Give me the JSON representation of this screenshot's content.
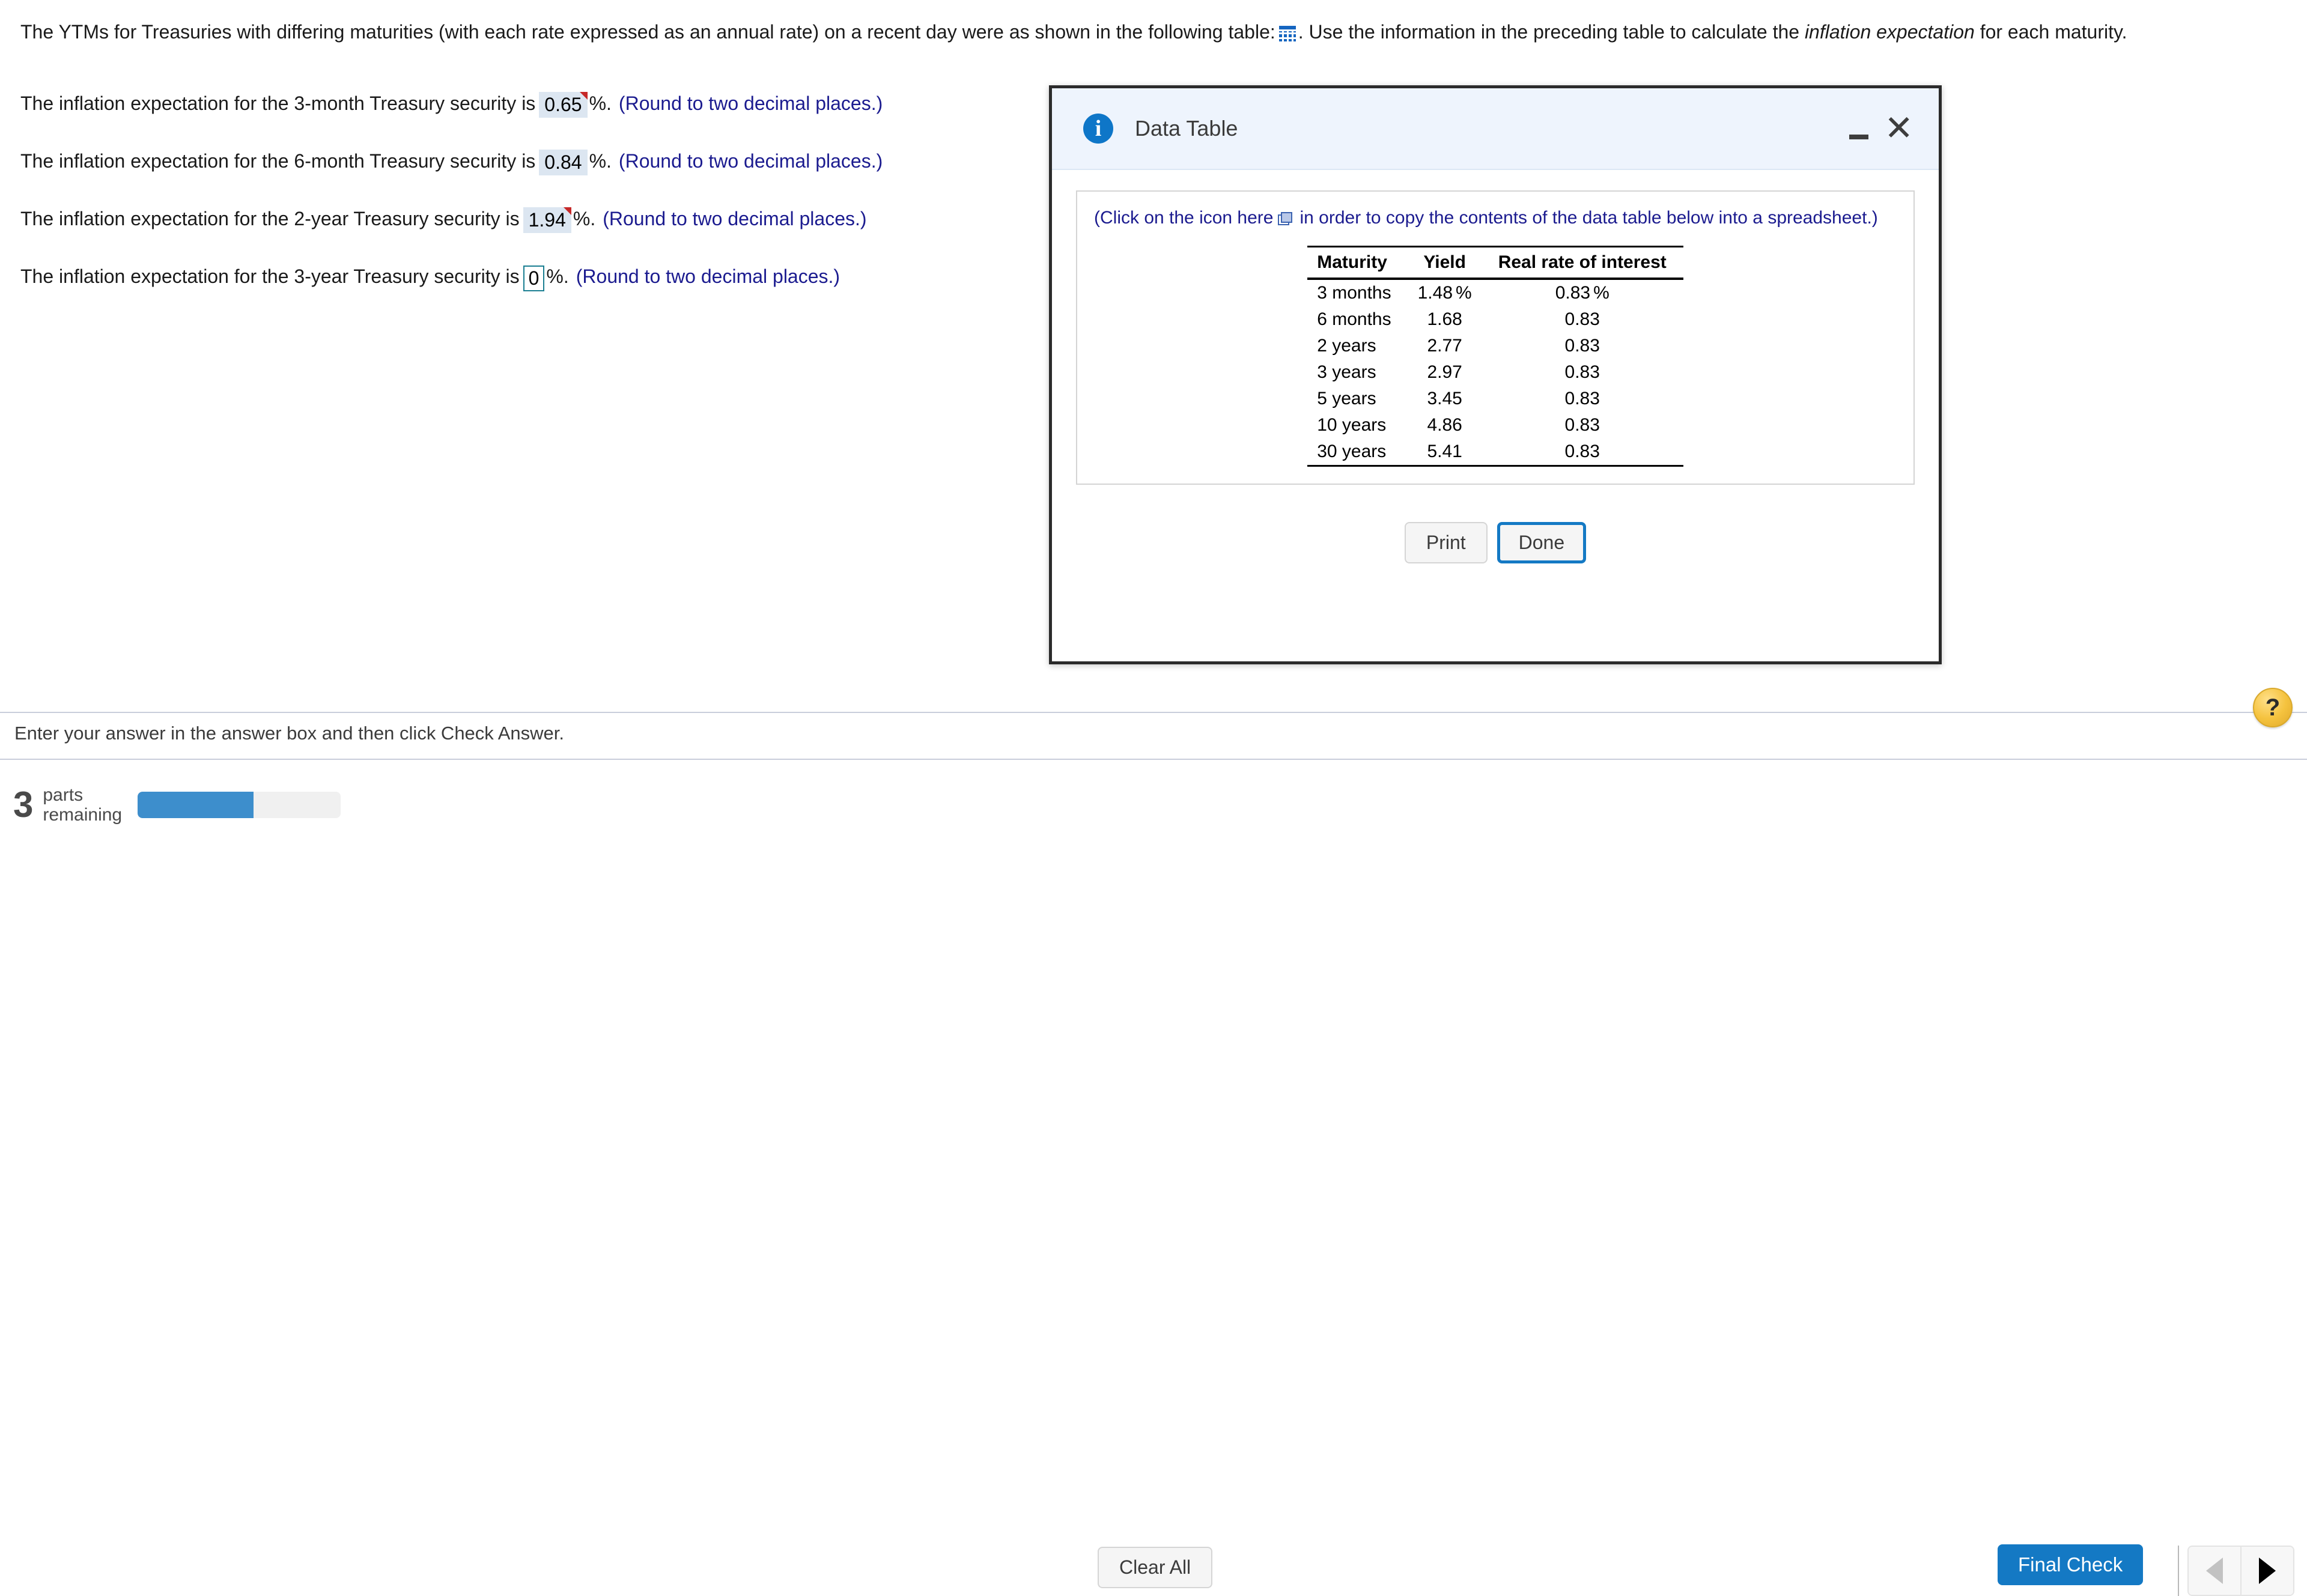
{
  "problem": {
    "prompt_part1": "The YTMs for Treasuries with differing maturities (with each rate expressed as an annual rate) on a recent day were as shown in the following table:",
    "prompt_part2": ". Use the information in the preceding table to calculate the",
    "prompt_emphasis": "inflation expectation",
    "prompt_part3": "for each maturity.",
    "table_icon_name": "table-icon",
    "answers": [
      {
        "lead": "The inflation expectation for the 3-month Treasury security is",
        "value": "0.65",
        "unit": "%.",
        "hint": "(Round to two decimal places.)",
        "state": "filled",
        "flagged": true
      },
      {
        "lead": "The inflation expectation for the 6-month Treasury security is",
        "value": "0.84",
        "unit": "%.",
        "hint": "(Round to two decimal places.)",
        "state": "filled",
        "flagged": false
      },
      {
        "lead": "The inflation expectation for the 2-year Treasury security is",
        "value": "1.94",
        "unit": "%.",
        "hint": "(Round to two decimal places.)",
        "state": "filled",
        "flagged": true
      },
      {
        "lead": "The inflation expectation for the 3-year Treasury security is",
        "value": "0",
        "unit": "%.",
        "hint": "(Round to two decimal places.)",
        "state": "active",
        "flagged": false
      }
    ]
  },
  "dialog": {
    "title": "Data Table",
    "info_icon": "info-icon",
    "minimize_label": "minimize",
    "close_label": "✕",
    "copy_note_before": "(Click on the icon here",
    "copy_note_after": "in order to copy the contents of the data table below into a spreadsheet.)",
    "copy_icon_name": "copy-icon",
    "table": {
      "headers": [
        "Maturity",
        "Yield",
        "Real rate of interest"
      ],
      "rows": [
        {
          "maturity": "3 months",
          "yield": "1.48",
          "yield_unit": "%",
          "real_rate": "0.83",
          "real_rate_unit": "%"
        },
        {
          "maturity": "6 months",
          "yield": "1.68",
          "yield_unit": "",
          "real_rate": "0.83",
          "real_rate_unit": ""
        },
        {
          "maturity": "2 years",
          "yield": "2.77",
          "yield_unit": "",
          "real_rate": "0.83",
          "real_rate_unit": ""
        },
        {
          "maturity": "3 years",
          "yield": "2.97",
          "yield_unit": "",
          "real_rate": "0.83",
          "real_rate_unit": ""
        },
        {
          "maturity": "5 years",
          "yield": "3.45",
          "yield_unit": "",
          "real_rate": "0.83",
          "real_rate_unit": ""
        },
        {
          "maturity": "10 years",
          "yield": "4.86",
          "yield_unit": "",
          "real_rate": "0.83",
          "real_rate_unit": ""
        },
        {
          "maturity": "30 years",
          "yield": "5.41",
          "yield_unit": "",
          "real_rate": "0.83",
          "real_rate_unit": ""
        }
      ]
    },
    "print_label": "Print",
    "done_label": "Done"
  },
  "footer": {
    "instruction": "Enter your answer in the answer box and then click Check Answer.",
    "help_label": "?",
    "parts_count": "3",
    "parts_label_line1": "parts",
    "parts_label_line2": "remaining",
    "progress_percent": 57,
    "clear_all_label": "Clear All",
    "final_check_label": "Final Check",
    "prev_label": "◀",
    "next_label": "▶"
  },
  "colors": {
    "accent_blue": "#1479c4",
    "hint_blue": "#1b1b8f",
    "answer_box_bg": "#dce6f1",
    "flag_red": "#c62828",
    "active_border": "#1b7f92",
    "help_yellow": "#f5c33f"
  }
}
